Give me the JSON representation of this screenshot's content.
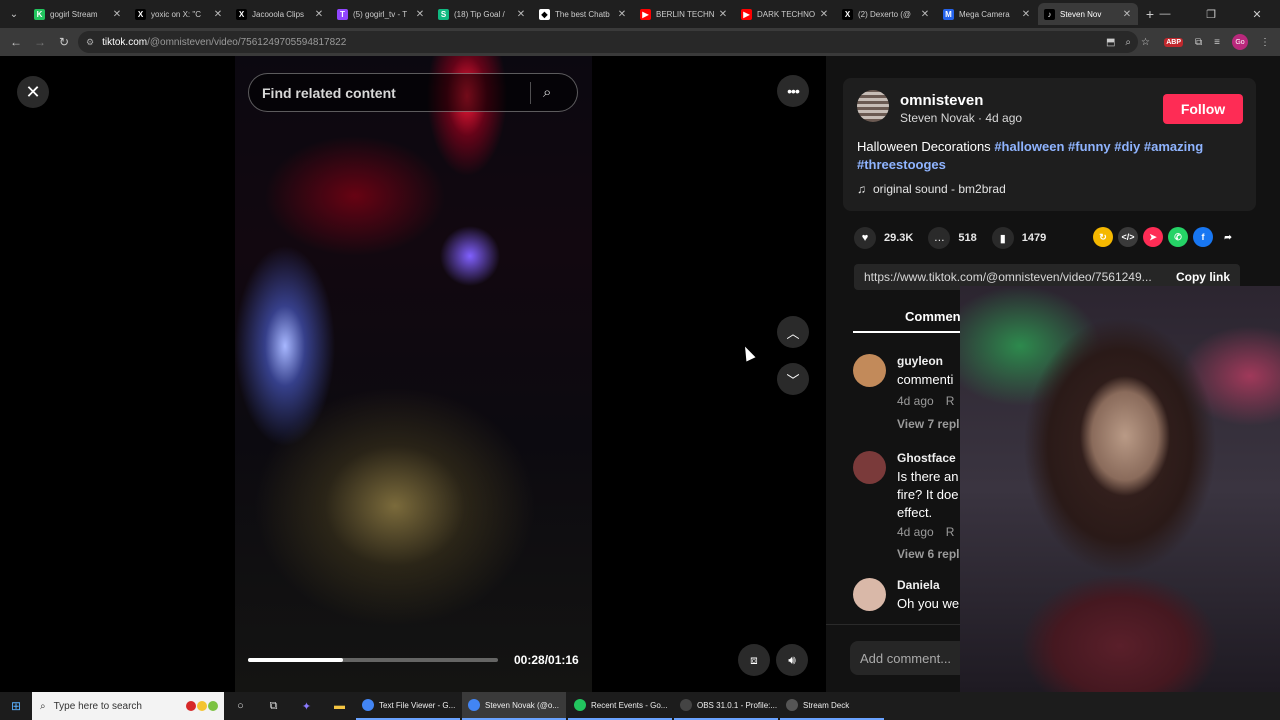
{
  "browser": {
    "tabs": [
      {
        "title": "gogirl Stream",
        "color": "#22c55e",
        "glyph": "K"
      },
      {
        "title": "yoxic on X: \"C",
        "color": "#000000",
        "glyph": "X"
      },
      {
        "title": "Jacooola Clips",
        "color": "#000000",
        "glyph": "X"
      },
      {
        "title": "(5) gogirl_tv - T",
        "color": "#9146ff",
        "glyph": "T"
      },
      {
        "title": "(18) Tip Goal /",
        "color": "#10b981",
        "glyph": "S"
      },
      {
        "title": "The best Chatb",
        "color": "#ffffff",
        "glyph": "◆"
      },
      {
        "title": "BERLIN TECHN",
        "color": "#ff0000",
        "glyph": "▶"
      },
      {
        "title": "DARK TECHNO",
        "color": "#ff0000",
        "glyph": "▶"
      },
      {
        "title": "(2) Dexerto (@",
        "color": "#000000",
        "glyph": "X"
      },
      {
        "title": "Mega Camera",
        "color": "#2563eb",
        "glyph": "M"
      },
      {
        "title": "Steven Nov",
        "color": "#000000",
        "glyph": "♪"
      }
    ],
    "url_host": "tiktok.com",
    "url_path": "/@omnisteven/video/7561249705594817822"
  },
  "search": {
    "placeholder": "Find related content"
  },
  "video": {
    "time": "00:28/01:16",
    "progress_fraction": 0.38
  },
  "post": {
    "username": "omnisteven",
    "subname": "Steven Novak · 4d ago",
    "follow_label": "Follow",
    "description_text": "Halloween Decorations",
    "hashtags": [
      "#halloween",
      "#funny",
      "#diy",
      "#amazing",
      "#threestooges"
    ],
    "sound": "original sound - bm2brad",
    "likes": "29.3K",
    "comments": "518",
    "saves": "1479",
    "link": "https://www.tiktok.com/@omnisteven/video/7561249...",
    "copy_label": "Copy link",
    "comments_tab": "Comment"
  },
  "comments": [
    {
      "name": "guyleon",
      "text": "commenti",
      "meta": "4d ago",
      "reply": "R",
      "view": "View 7 repli",
      "avatar_color": "#c28a5a"
    },
    {
      "name": "Ghostface",
      "text": "Is there an fire? It doe effect.",
      "meta": "4d ago",
      "reply": "R",
      "view": "View 6 repli",
      "avatar_color": "#7a3a3a"
    },
    {
      "name": "Daniela",
      "text": "Oh you we",
      "meta": "",
      "reply": "",
      "view": "",
      "avatar_color": "#d9b8a8"
    }
  ],
  "add_comment_placeholder": "Add comment...",
  "taskbar": {
    "search_placeholder": "Type here to search",
    "apps": [
      {
        "title": "Text File Viewer - G...",
        "color": "#4285f4"
      },
      {
        "title": "Steven Novak (@o...",
        "color": "#4285f4"
      },
      {
        "title": "Recent Events - Go...",
        "color": "#22c55e"
      },
      {
        "title": "OBS 31.0.1 - Profile:...",
        "color": "#444444"
      },
      {
        "title": "Stream Deck",
        "color": "#555555"
      }
    ]
  }
}
